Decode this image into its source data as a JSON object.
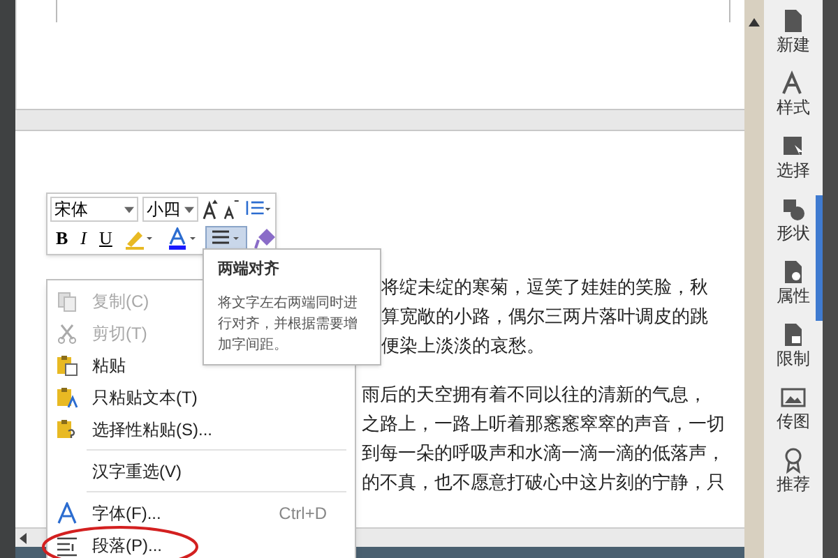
{
  "document": {
    "paragraphs": [
      {
        "lines": [
          "将绽未绽的寒菊，逗笑了娃娃的笑脸，秋",
          "算宽敞的小路，偶尔三两片落叶调皮的跳",
          "便染上淡淡的哀愁。"
        ]
      },
      {
        "lines": [
          "雨后的天空拥有着不同以往的清新的气息，",
          "之路上，一路上听着那窸窸窣窣的声音，一切",
          "到每一朵的呼吸声和水滴一滴一滴的低落声，",
          "的不真，也不愿意打破心中这片刻的宁静，只"
        ]
      }
    ]
  },
  "mini_toolbar": {
    "font": "宋体",
    "size": "小四",
    "buttons": [
      {
        "kind": "bold",
        "label": "B",
        "selected": false
      },
      {
        "kind": "italic",
        "label": "I",
        "selected": false
      },
      {
        "kind": "underline",
        "label": "U",
        "selected": false
      },
      {
        "kind": "highlight",
        "selected": false
      },
      {
        "kind": "font_color",
        "selected": false
      },
      {
        "kind": "align",
        "selected": true
      },
      {
        "kind": "painter",
        "selected": false
      }
    ]
  },
  "tooltip": {
    "title": "两端对齐",
    "text": "将文字左右两端同时进行对齐，并根据需要增加字间距。"
  },
  "context_menu": [
    {
      "kind": "item",
      "label": "复制(C)",
      "disabled": true
    },
    {
      "kind": "item",
      "label": "剪切(T)",
      "disabled": true
    },
    {
      "kind": "item",
      "label": "粘贴",
      "disabled": false
    },
    {
      "kind": "item",
      "label": "只粘贴文本(T)",
      "disabled": false
    },
    {
      "kind": "item",
      "label": "选择性粘贴(S)...",
      "disabled": false
    },
    {
      "kind": "separator"
    },
    {
      "kind": "item",
      "label": "汉字重选(V)",
      "disabled": false
    },
    {
      "kind": "separator"
    },
    {
      "kind": "item",
      "label": "字体(F)...",
      "shortcut": "Ctrl+D",
      "disabled": false
    },
    {
      "kind": "item",
      "label": "段落(P)...",
      "disabled": false,
      "circled": true
    }
  ],
  "side_panel": [
    {
      "label": "新建"
    },
    {
      "label": "样式"
    },
    {
      "label": "选择"
    },
    {
      "label": "形状"
    },
    {
      "label": "属性"
    },
    {
      "label": "限制"
    },
    {
      "label": "传图"
    },
    {
      "label": "推荐"
    }
  ]
}
